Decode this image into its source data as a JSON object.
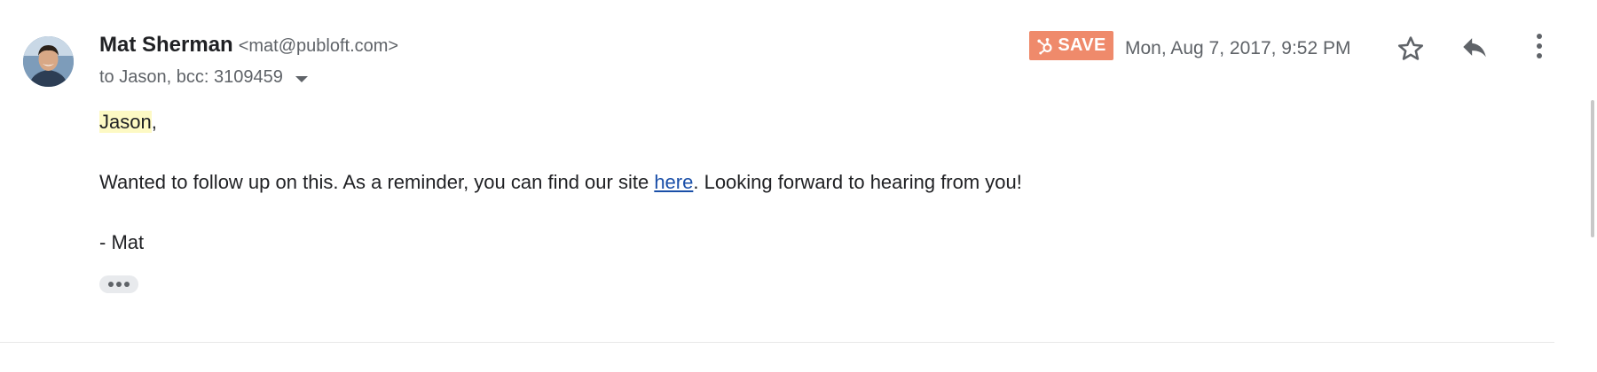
{
  "sender": {
    "name": "Mat Sherman",
    "email": "<mat@publoft.com>",
    "avatar_icon": "person-avatar"
  },
  "recipients": {
    "text": "to Jason, bcc: 3109459"
  },
  "header": {
    "save_label": "SAVE",
    "save_icon": "hubspot-sprocket-icon",
    "save_color": "#ef8a6b",
    "date": "Mon, Aug 7, 2017, 9:52 PM",
    "star_icon": "star-outline-icon",
    "reply_icon": "reply-arrow-icon",
    "more_icon": "vertical-dots-icon"
  },
  "body": {
    "greeting_name": "Jason",
    "greeting_suffix": ",",
    "paragraph_before_link": "Wanted to follow up on this. As a reminder, you can find our site ",
    "link_text": "here",
    "paragraph_after_link": ". Looking forward to hearing from you!",
    "signature": "- Mat",
    "link_color": "#1a4fa8",
    "highlight_color": "#fdf9c4"
  }
}
